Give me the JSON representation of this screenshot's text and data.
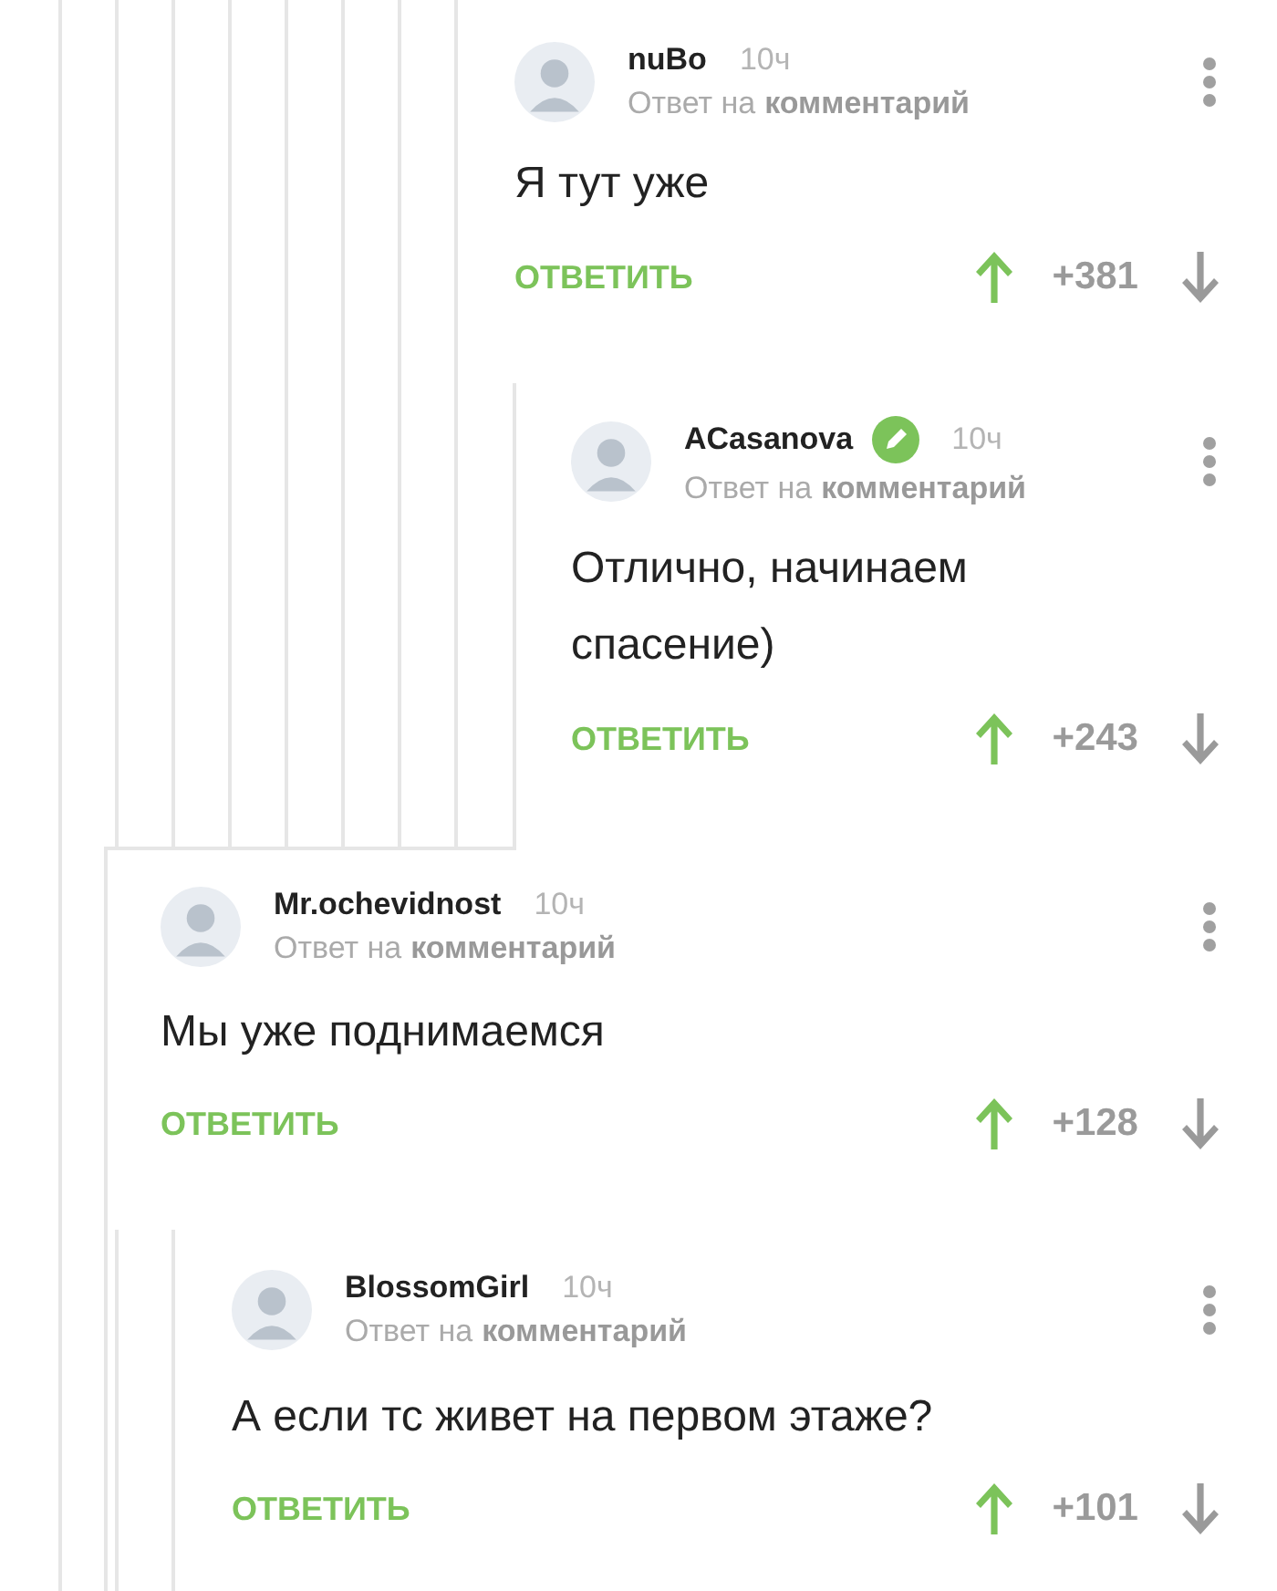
{
  "comments": [
    {
      "author": "nuBo",
      "badge": false,
      "time": "10ч",
      "reply_prefix": "Ответ на",
      "reply_link": "комментарий",
      "text": "Я тут уже",
      "action": "ОТВЕТИТЬ",
      "score": "+381",
      "children": [
        {
          "author": "ACasanova",
          "badge": true,
          "time": "10ч",
          "reply_prefix": "Ответ на",
          "reply_link": "комментарий",
          "text": "Отлично, начинаем спасение)",
          "action": "ОТВЕТИТЬ",
          "score": "+243"
        }
      ]
    },
    {
      "author": "Mr.ochevidnost",
      "badge": false,
      "time": "10ч",
      "reply_prefix": "Ответ на",
      "reply_link": "комментарий",
      "text": "Мы уже поднимаемся",
      "action": "ОТВЕТИТЬ",
      "score": "+128",
      "children": [
        {
          "author": "BlossomGirl",
          "badge": false,
          "time": "10ч",
          "reply_prefix": "Ответ на",
          "reply_link": "комментарий",
          "text": "А если тс живет на первом этаже?",
          "action": "ОТВЕТИТЬ",
          "score": "+101"
        }
      ]
    }
  ]
}
